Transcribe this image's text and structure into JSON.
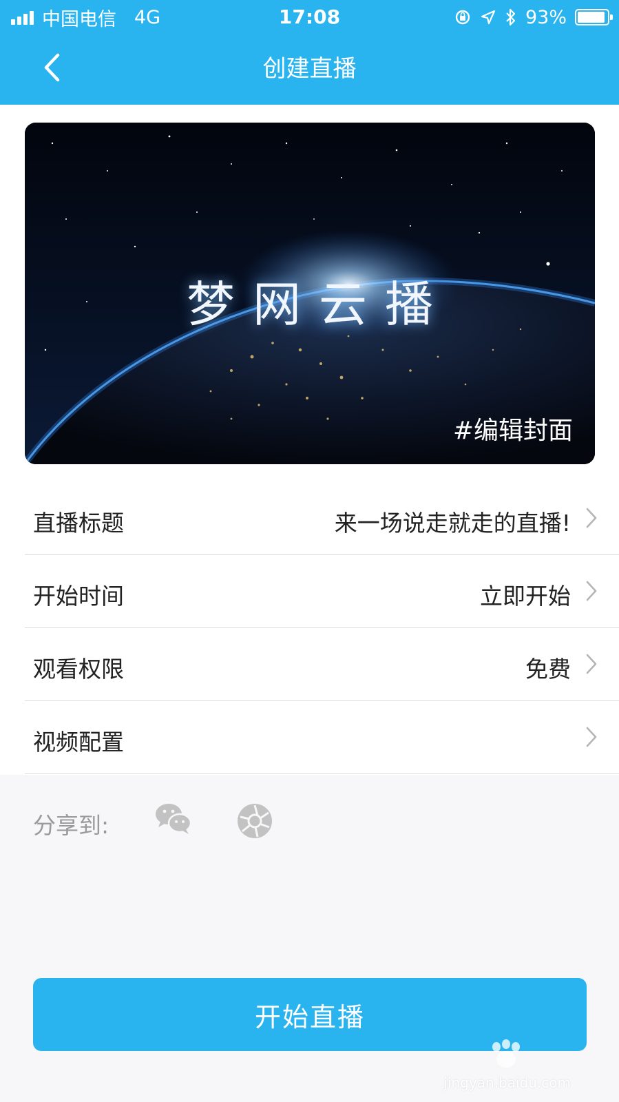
{
  "status_bar": {
    "carrier": "中国电信",
    "network": "4G",
    "time": "17:08",
    "battery": "93%"
  },
  "nav": {
    "title": "创建直播"
  },
  "cover": {
    "title": "梦网云播",
    "edit_label": "#编辑封面"
  },
  "settings": {
    "rows": [
      {
        "label": "直播标题",
        "value": "来一场说走就走的直播!"
      },
      {
        "label": "开始时间",
        "value": "立即开始"
      },
      {
        "label": "观看权限",
        "value": "免费"
      },
      {
        "label": "视频配置",
        "value": ""
      }
    ]
  },
  "share": {
    "label": "分享到:",
    "targets": [
      "wechat-icon",
      "moments-icon"
    ]
  },
  "actions": {
    "start_label": "开始直播"
  },
  "watermark": {
    "text": "jingyan.baidu.com"
  },
  "colors": {
    "accent": "#29b4ef",
    "divider": "#dcdcdc",
    "muted_text": "#9a9a9a"
  }
}
